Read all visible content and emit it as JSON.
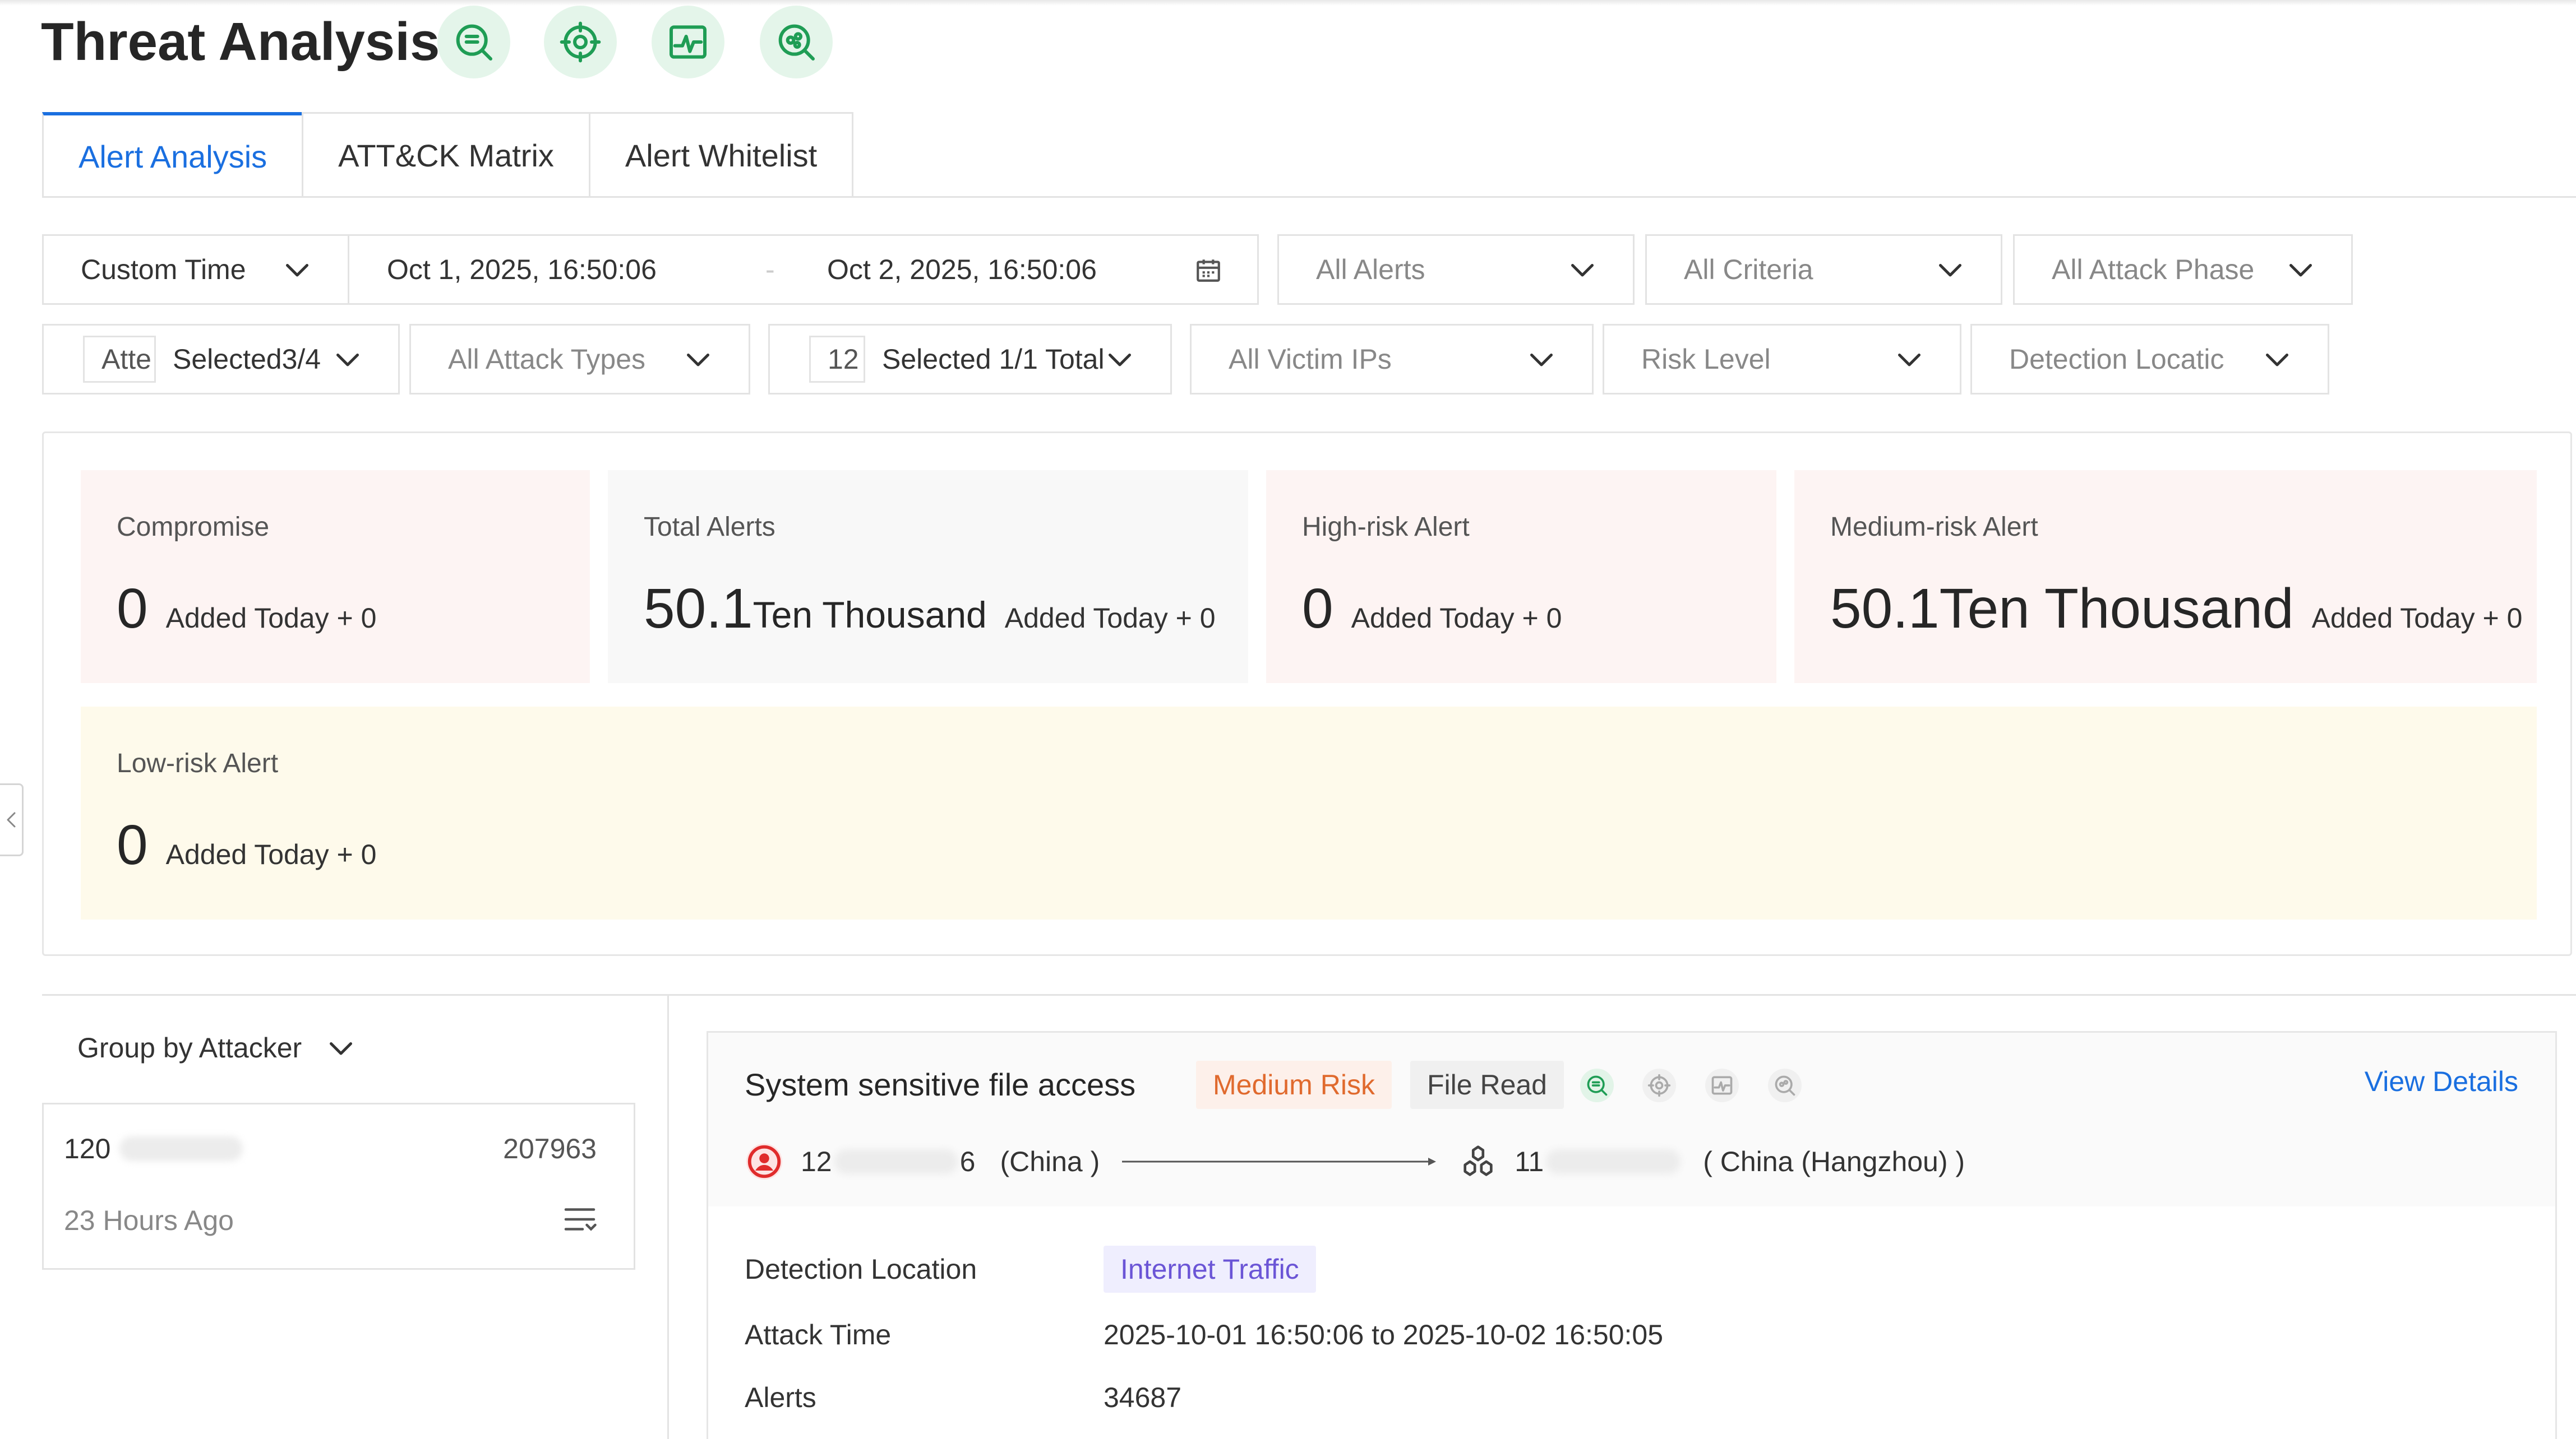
{
  "header": {
    "title": "Threat Analysis"
  },
  "header_icons": [
    "search-list-icon",
    "target-icon",
    "activity-chart-icon",
    "scan-search-icon"
  ],
  "tabs": [
    {
      "label": "Alert Analysis",
      "active": true
    },
    {
      "label": "ATT&CK Matrix",
      "active": false
    },
    {
      "label": "Alert Whitelist",
      "active": false
    }
  ],
  "filters": {
    "time_mode": "Custom Time",
    "start": "Oct 1, 2025, 16:50:06",
    "separator": "-",
    "end": "Oct 2, 2025, 16:50:06",
    "alerts": "All Alerts",
    "criteria": "All Criteria",
    "attack_phase": "All Attack Phase",
    "attacker_prefix": "Atte",
    "attacker_selected": "Selected3/4",
    "attack_types": "All Attack Types",
    "source_prefix": "12",
    "source_selected": "Selected 1/1 Total",
    "victim_ips": "All Victim IPs",
    "risk_level": "Risk Level",
    "detection_location": "Detection Locatic"
  },
  "stats": {
    "compromise": {
      "label": "Compromise",
      "value": "0",
      "unit": "",
      "added": "Added Today + 0"
    },
    "total": {
      "label": "Total Alerts",
      "value": "50.1",
      "unit": "Ten Thousand",
      "added": "Added Today + 0"
    },
    "high": {
      "label": "High-risk Alert",
      "value": "0",
      "unit": "",
      "added": "Added Today + 0"
    },
    "medium": {
      "label": "Medium-risk Alert",
      "value": "50.1",
      "unit": "Ten Thousand",
      "added": "Added Today + 0"
    },
    "low": {
      "label": "Low-risk Alert",
      "value": "0",
      "unit": "",
      "added": "Added Today + 0"
    }
  },
  "group_by": {
    "label": "Group by Attacker"
  },
  "attacker": {
    "ip_prefix": "120",
    "count": "207963",
    "time": "23 Hours Ago"
  },
  "alert": {
    "title": "System sensitive file access",
    "risk": "Medium Risk",
    "type": "File Read",
    "view_details": "View Details",
    "src_prefix": "12",
    "src_suffix": "6",
    "src_region": "(China )",
    "dst_prefix": "11",
    "dst_region": "( China (Hangzhou) )",
    "detection_location_label": "Detection Location",
    "detection_location": "Internet Traffic",
    "attack_time_label": "Attack Time",
    "attack_time": "2025-10-01 16:50:06 to 2025-10-02 16:50:05",
    "alerts_label": "Alerts",
    "alerts_count": "34687"
  },
  "colors": {
    "accent": "#1a6fe0",
    "icon_green": "#1f9d55",
    "medium_risk": "#e06a2e",
    "traffic_tag": "#6b55d6"
  }
}
